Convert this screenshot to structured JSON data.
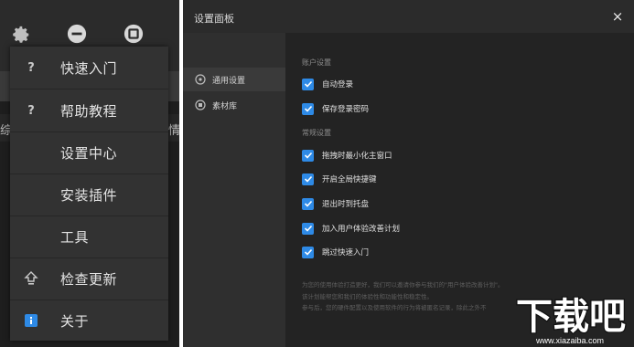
{
  "left_menu": {
    "items": [
      {
        "label": "快速入门",
        "icon": "help-icon"
      },
      {
        "label": "帮助教程",
        "icon": "help-icon"
      },
      {
        "label": "设置中心",
        "icon": ""
      },
      {
        "label": "安装插件",
        "icon": ""
      },
      {
        "label": "工具",
        "icon": ""
      },
      {
        "label": "检查更新",
        "icon": "update-icon"
      },
      {
        "label": "关于",
        "icon": "info-icon"
      }
    ],
    "edge_left": "综",
    "edge_right": "情"
  },
  "settings": {
    "title": "设置面板",
    "close": "×",
    "sidebar": [
      {
        "label": "通用设置",
        "active": true
      },
      {
        "label": "素材库",
        "active": false
      }
    ],
    "sections": [
      {
        "header": "账户设置",
        "options": [
          {
            "label": "自动登录",
            "checked": true
          },
          {
            "label": "保存登录密码",
            "checked": true
          }
        ]
      },
      {
        "header": "常规设置",
        "options": [
          {
            "label": "拖拽时最小化主窗口",
            "checked": true
          },
          {
            "label": "开启全局快捷键",
            "checked": true
          },
          {
            "label": "退出时到托盘",
            "checked": true
          },
          {
            "label": "加入用户体验改善计划",
            "checked": true
          },
          {
            "label": "跳过快速入门",
            "checked": true
          }
        ]
      }
    ],
    "description": [
      "为您的使用体验打造更好，我们可以邀请你参与我们的\"用户体验改善计划\"。",
      "该计划能帮您和我们的体验性和功能性和稳定性。",
      "参与后，您的硬件配置以及使用软件的行为将被匿名记录，除此之外不"
    ]
  },
  "watermark": {
    "logo_text": "下载吧",
    "url": "www.xiazaiba.com"
  },
  "colors": {
    "checkbox": "#2e8ae6",
    "panel_bg": "#2b2b2b",
    "content_bg": "#232323"
  }
}
